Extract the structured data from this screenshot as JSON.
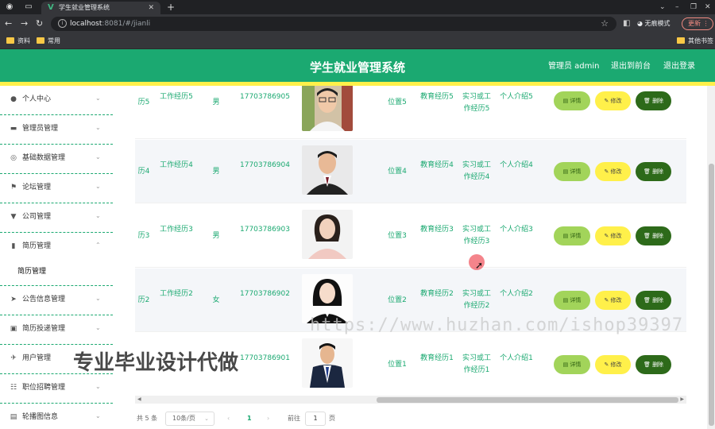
{
  "browser": {
    "tab_title": "学生就业管理系统",
    "url_host": "localhost",
    "url_path": ":8081/#/jianli",
    "incognito_label": "无痕模式",
    "update_label": "更新",
    "bookmarks": [
      "资料",
      "常用"
    ],
    "other_bookmarks": "其他书签"
  },
  "header": {
    "title": "学生就业管理系统",
    "user": "管理员 admin",
    "back_front": "退出到前台",
    "logout": "退出登录"
  },
  "sidebar": {
    "items": [
      {
        "label": "个人中心",
        "icon": "person-icon"
      },
      {
        "label": "管理员管理",
        "icon": "monitor-icon"
      },
      {
        "label": "基础数据管理",
        "icon": "compass-icon"
      },
      {
        "label": "论坛管理",
        "icon": "flag-icon"
      },
      {
        "label": "公司管理",
        "icon": "building-icon"
      },
      {
        "label": "简历管理",
        "icon": "chart-icon",
        "expanded": true
      },
      {
        "label": "公告信息管理",
        "icon": "send-icon"
      },
      {
        "label": "简历投递管理",
        "icon": "box-icon"
      },
      {
        "label": "用户管理",
        "icon": "plane-icon"
      },
      {
        "label": "职位招聘管理",
        "icon": "grid-icon"
      },
      {
        "label": "轮播图信息",
        "icon": "message-icon"
      }
    ],
    "sub_item": "简历管理"
  },
  "table": {
    "rows": [
      {
        "name": "历5",
        "work": "工作经历5",
        "gender": "男",
        "phone": "17703786905",
        "location": "位置5",
        "edu": "教育经历5",
        "intern": "实习或工作经历5",
        "intro": "个人介绍5"
      },
      {
        "name": "历4",
        "work": "工作经历4",
        "gender": "男",
        "phone": "17703786904",
        "location": "位置4",
        "edu": "教育经历4",
        "intern": "实习或工作经历4",
        "intro": "个人介绍4"
      },
      {
        "name": "历3",
        "work": "工作经历3",
        "gender": "男",
        "phone": "17703786903",
        "location": "位置3",
        "edu": "教育经历3",
        "intern": "实习或工作经历3",
        "intro": "个人介绍3"
      },
      {
        "name": "历2",
        "work": "工作经历2",
        "gender": "女",
        "phone": "17703786902",
        "location": "位置2",
        "edu": "教育经历2",
        "intern": "实习或工作经历2",
        "intro": "个人介绍2"
      },
      {
        "name": "",
        "work": "",
        "gender": "",
        "phone": "17703786901",
        "location": "位置1",
        "edu": "教育经历1",
        "intern": "实习或工作经历1",
        "intro": "个人介绍1"
      }
    ],
    "buttons": {
      "detail": "详情",
      "edit": "修改",
      "delete": "删除"
    }
  },
  "pager": {
    "total": "共 5 条",
    "page_size": "10条/页",
    "current": "1",
    "goto_label": "前往",
    "goto_value": "1",
    "page_unit": "页"
  },
  "overlay": {
    "watermark_url": "https://www.huzhan.com/ishop39397",
    "watermark_text": "专业毕业设计代做"
  }
}
